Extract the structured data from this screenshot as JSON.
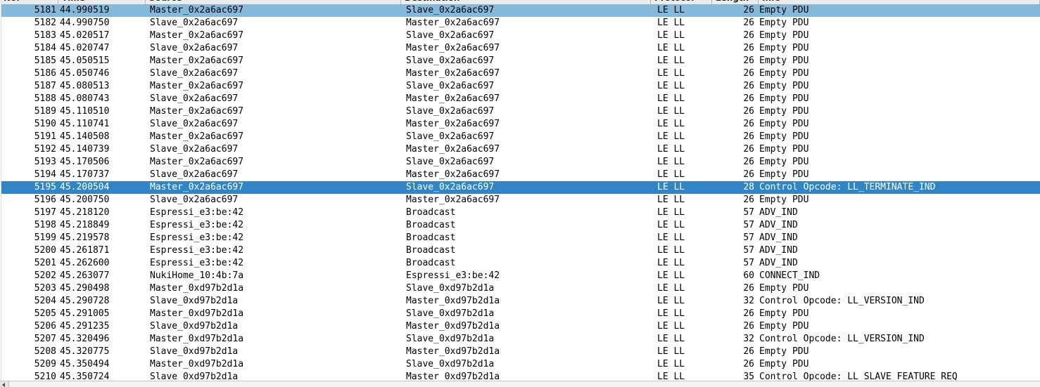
{
  "window": {
    "app": "Wireshark",
    "view": "packet-list"
  },
  "columns": [
    {
      "key": "no",
      "label": "No."
    },
    {
      "key": "time",
      "label": "Time"
    },
    {
      "key": "source",
      "label": "Source"
    },
    {
      "key": "dest",
      "label": "Destination"
    },
    {
      "key": "protocol",
      "label": "Protocol"
    },
    {
      "key": "length",
      "label": "Length"
    },
    {
      "key": "info",
      "label": "Info"
    }
  ],
  "colors": {
    "row_highlight_light": "#85b9dc",
    "row_selected": "#2e86c5",
    "row_default_bg": "#ffffff",
    "header_bg": "#ececec",
    "text": "#000000",
    "selected_text": "#ffffff"
  },
  "packets": [
    {
      "no": "5181",
      "time": "44.990519",
      "source": "Master_0x2a6ac697",
      "dest": "Slave_0x2a6ac697",
      "protocol": "LE LL",
      "length": "26",
      "info": "Empty PDU",
      "state": "highlight"
    },
    {
      "no": "5182",
      "time": "44.990750",
      "source": "Slave_0x2a6ac697",
      "dest": "Master_0x2a6ac697",
      "protocol": "LE LL",
      "length": "26",
      "info": "Empty PDU",
      "state": "normal"
    },
    {
      "no": "5183",
      "time": "45.020517",
      "source": "Master_0x2a6ac697",
      "dest": "Slave_0x2a6ac697",
      "protocol": "LE LL",
      "length": "26",
      "info": "Empty PDU",
      "state": "normal"
    },
    {
      "no": "5184",
      "time": "45.020747",
      "source": "Slave_0x2a6ac697",
      "dest": "Master_0x2a6ac697",
      "protocol": "LE LL",
      "length": "26",
      "info": "Empty PDU",
      "state": "normal"
    },
    {
      "no": "5185",
      "time": "45.050515",
      "source": "Master_0x2a6ac697",
      "dest": "Slave_0x2a6ac697",
      "protocol": "LE LL",
      "length": "26",
      "info": "Empty PDU",
      "state": "normal"
    },
    {
      "no": "5186",
      "time": "45.050746",
      "source": "Slave_0x2a6ac697",
      "dest": "Master_0x2a6ac697",
      "protocol": "LE LL",
      "length": "26",
      "info": "Empty PDU",
      "state": "normal"
    },
    {
      "no": "5187",
      "time": "45.080513",
      "source": "Master_0x2a6ac697",
      "dest": "Slave_0x2a6ac697",
      "protocol": "LE LL",
      "length": "26",
      "info": "Empty PDU",
      "state": "normal"
    },
    {
      "no": "5188",
      "time": "45.080743",
      "source": "Slave_0x2a6ac697",
      "dest": "Master_0x2a6ac697",
      "protocol": "LE LL",
      "length": "26",
      "info": "Empty PDU",
      "state": "normal"
    },
    {
      "no": "5189",
      "time": "45.110510",
      "source": "Master_0x2a6ac697",
      "dest": "Slave_0x2a6ac697",
      "protocol": "LE LL",
      "length": "26",
      "info": "Empty PDU",
      "state": "normal"
    },
    {
      "no": "5190",
      "time": "45.110741",
      "source": "Slave_0x2a6ac697",
      "dest": "Master_0x2a6ac697",
      "protocol": "LE LL",
      "length": "26",
      "info": "Empty PDU",
      "state": "normal"
    },
    {
      "no": "5191",
      "time": "45.140508",
      "source": "Master_0x2a6ac697",
      "dest": "Slave_0x2a6ac697",
      "protocol": "LE LL",
      "length": "26",
      "info": "Empty PDU",
      "state": "normal"
    },
    {
      "no": "5192",
      "time": "45.140739",
      "source": "Slave_0x2a6ac697",
      "dest": "Master_0x2a6ac697",
      "protocol": "LE LL",
      "length": "26",
      "info": "Empty PDU",
      "state": "normal"
    },
    {
      "no": "5193",
      "time": "45.170506",
      "source": "Master_0x2a6ac697",
      "dest": "Slave_0x2a6ac697",
      "protocol": "LE LL",
      "length": "26",
      "info": "Empty PDU",
      "state": "normal"
    },
    {
      "no": "5194",
      "time": "45.170737",
      "source": "Slave_0x2a6ac697",
      "dest": "Master_0x2a6ac697",
      "protocol": "LE LL",
      "length": "26",
      "info": "Empty PDU",
      "state": "normal"
    },
    {
      "no": "5195",
      "time": "45.200504",
      "source": "Master_0x2a6ac697",
      "dest": "Slave_0x2a6ac697",
      "protocol": "LE LL",
      "length": "28",
      "info": "Control Opcode: LL_TERMINATE_IND",
      "state": "selected"
    },
    {
      "no": "5196",
      "time": "45.200750",
      "source": "Slave_0x2a6ac697",
      "dest": "Master_0x2a6ac697",
      "protocol": "LE LL",
      "length": "26",
      "info": "Empty PDU",
      "state": "normal"
    },
    {
      "no": "5197",
      "time": "45.218120",
      "source": "Espressi_e3:be:42",
      "dest": "Broadcast",
      "protocol": "LE LL",
      "length": "57",
      "info": "ADV_IND",
      "state": "normal"
    },
    {
      "no": "5198",
      "time": "45.218849",
      "source": "Espressi_e3:be:42",
      "dest": "Broadcast",
      "protocol": "LE LL",
      "length": "57",
      "info": "ADV_IND",
      "state": "normal"
    },
    {
      "no": "5199",
      "time": "45.219578",
      "source": "Espressi_e3:be:42",
      "dest": "Broadcast",
      "protocol": "LE LL",
      "length": "57",
      "info": "ADV_IND",
      "state": "normal"
    },
    {
      "no": "5200",
      "time": "45.261871",
      "source": "Espressi_e3:be:42",
      "dest": "Broadcast",
      "protocol": "LE LL",
      "length": "57",
      "info": "ADV_IND",
      "state": "normal"
    },
    {
      "no": "5201",
      "time": "45.262600",
      "source": "Espressi_e3:be:42",
      "dest": "Broadcast",
      "protocol": "LE LL",
      "length": "57",
      "info": "ADV_IND",
      "state": "normal"
    },
    {
      "no": "5202",
      "time": "45.263077",
      "source": "NukiHome_10:4b:7a",
      "dest": "Espressi_e3:be:42",
      "protocol": "LE LL",
      "length": "60",
      "info": "CONNECT_IND",
      "state": "normal"
    },
    {
      "no": "5203",
      "time": "45.290498",
      "source": "Master_0xd97b2d1a",
      "dest": "Slave_0xd97b2d1a",
      "protocol": "LE LL",
      "length": "26",
      "info": "Empty PDU",
      "state": "normal"
    },
    {
      "no": "5204",
      "time": "45.290728",
      "source": "Slave_0xd97b2d1a",
      "dest": "Master_0xd97b2d1a",
      "protocol": "LE LL",
      "length": "32",
      "info": "Control Opcode: LL_VERSION_IND",
      "state": "normal"
    },
    {
      "no": "5205",
      "time": "45.291005",
      "source": "Master_0xd97b2d1a",
      "dest": "Slave_0xd97b2d1a",
      "protocol": "LE LL",
      "length": "26",
      "info": "Empty PDU",
      "state": "normal"
    },
    {
      "no": "5206",
      "time": "45.291235",
      "source": "Slave_0xd97b2d1a",
      "dest": "Master_0xd97b2d1a",
      "protocol": "LE LL",
      "length": "26",
      "info": "Empty PDU",
      "state": "normal"
    },
    {
      "no": "5207",
      "time": "45.320496",
      "source": "Master_0xd97b2d1a",
      "dest": "Slave_0xd97b2d1a",
      "protocol": "LE LL",
      "length": "32",
      "info": "Control Opcode: LL_VERSION_IND",
      "state": "normal"
    },
    {
      "no": "5208",
      "time": "45.320775",
      "source": "Slave_0xd97b2d1a",
      "dest": "Master_0xd97b2d1a",
      "protocol": "LE LL",
      "length": "26",
      "info": "Empty PDU",
      "state": "normal"
    },
    {
      "no": "5209",
      "time": "45.350494",
      "source": "Master_0xd97b2d1a",
      "dest": "Slave_0xd97b2d1a",
      "protocol": "LE LL",
      "length": "26",
      "info": "Empty PDU",
      "state": "normal"
    },
    {
      "no": "5210",
      "time": "45.350724",
      "source": "Slave_0xd97b2d1a",
      "dest": "Master_0xd97b2d1a",
      "protocol": "LE LL",
      "length": "35",
      "info": "Control Opcode: LL_SLAVE_FEATURE_REQ",
      "state": "normal"
    }
  ],
  "scrollbar": {
    "orientation": "horizontal",
    "left_arrow": "◀"
  }
}
